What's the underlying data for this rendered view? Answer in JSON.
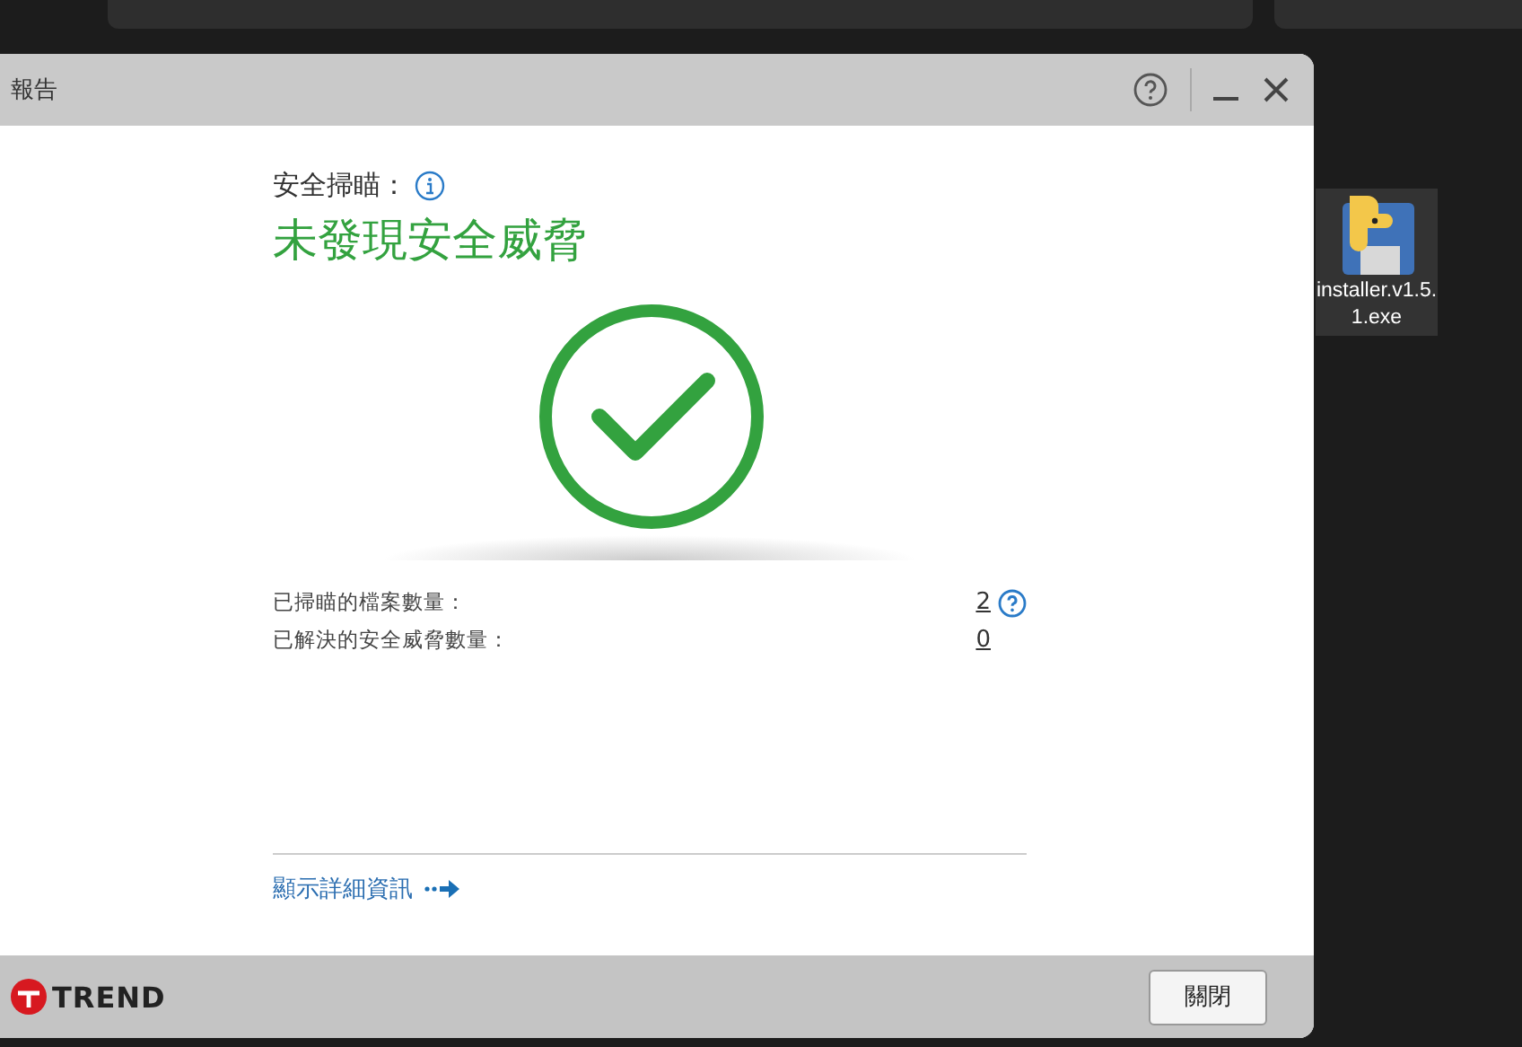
{
  "window": {
    "title": "報告"
  },
  "scan": {
    "label": "安全掃瞄：",
    "result": "未發現安全威脅"
  },
  "stats": [
    {
      "label": "已掃瞄的檔案數量：",
      "value": "2",
      "help": true
    },
    {
      "label": "已解決的安全威脅數量：",
      "value": "0",
      "help": false
    }
  ],
  "details_link": "顯示詳細資訊",
  "footer": {
    "logo": "TREND",
    "button": "關閉"
  },
  "desktop_icon": {
    "label": "installer.v1.5.1.exe"
  }
}
